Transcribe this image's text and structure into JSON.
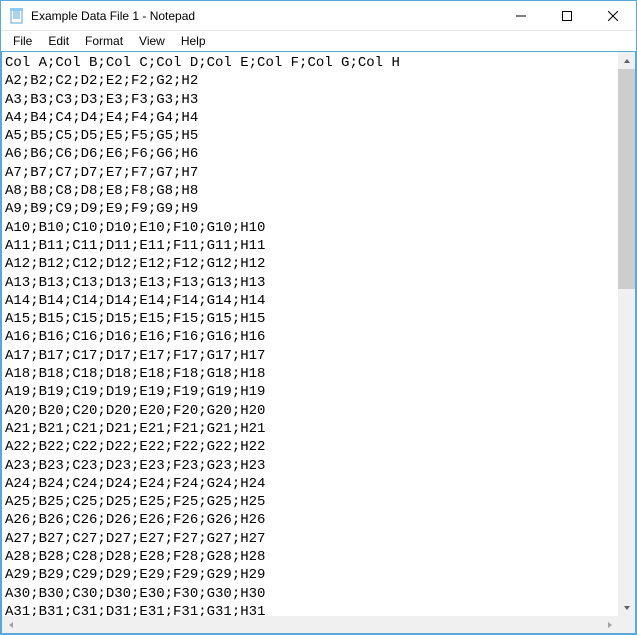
{
  "window": {
    "title": "Example Data File 1 - Notepad"
  },
  "menu": {
    "file": "File",
    "edit": "Edit",
    "format": "Format",
    "view": "View",
    "help": "Help"
  },
  "editor": {
    "header": "Col A;Col B;Col C;Col D;Col E;Col F;Col G;Col H",
    "rows": [
      "A2;B2;C2;D2;E2;F2;G2;H2",
      "A3;B3;C3;D3;E3;F3;G3;H3",
      "A4;B4;C4;D4;E4;F4;G4;H4",
      "A5;B5;C5;D5;E5;F5;G5;H5",
      "A6;B6;C6;D6;E6;F6;G6;H6",
      "A7;B7;C7;D7;E7;F7;G7;H7",
      "A8;B8;C8;D8;E8;F8;G8;H8",
      "A9;B9;C9;D9;E9;F9;G9;H9",
      "A10;B10;C10;D10;E10;F10;G10;H10",
      "A11;B11;C11;D11;E11;F11;G11;H11",
      "A12;B12;C12;D12;E12;F12;G12;H12",
      "A13;B13;C13;D13;E13;F13;G13;H13",
      "A14;B14;C14;D14;E14;F14;G14;H14",
      "A15;B15;C15;D15;E15;F15;G15;H15",
      "A16;B16;C16;D16;E16;F16;G16;H16",
      "A17;B17;C17;D17;E17;F17;G17;H17",
      "A18;B18;C18;D18;E18;F18;G18;H18",
      "A19;B19;C19;D19;E19;F19;G19;H19",
      "A20;B20;C20;D20;E20;F20;G20;H20",
      "A21;B21;C21;D21;E21;F21;G21;H21",
      "A22;B22;C22;D22;E22;F22;G22;H22",
      "A23;B23;C23;D23;E23;F23;G23;H23",
      "A24;B24;C24;D24;E24;F24;G24;H24",
      "A25;B25;C25;D25;E25;F25;G25;H25",
      "A26;B26;C26;D26;E26;F26;G26;H26",
      "A27;B27;C27;D27;E27;F27;G27;H27",
      "A28;B28;C28;D28;E28;F28;G28;H28",
      "A29;B29;C29;D29;E29;F29;G29;H29",
      "A30;B30;C30;D30;E30;F30;G30;H30",
      "A31;B31;C31;D31;E31;F31;G31;H31"
    ]
  }
}
